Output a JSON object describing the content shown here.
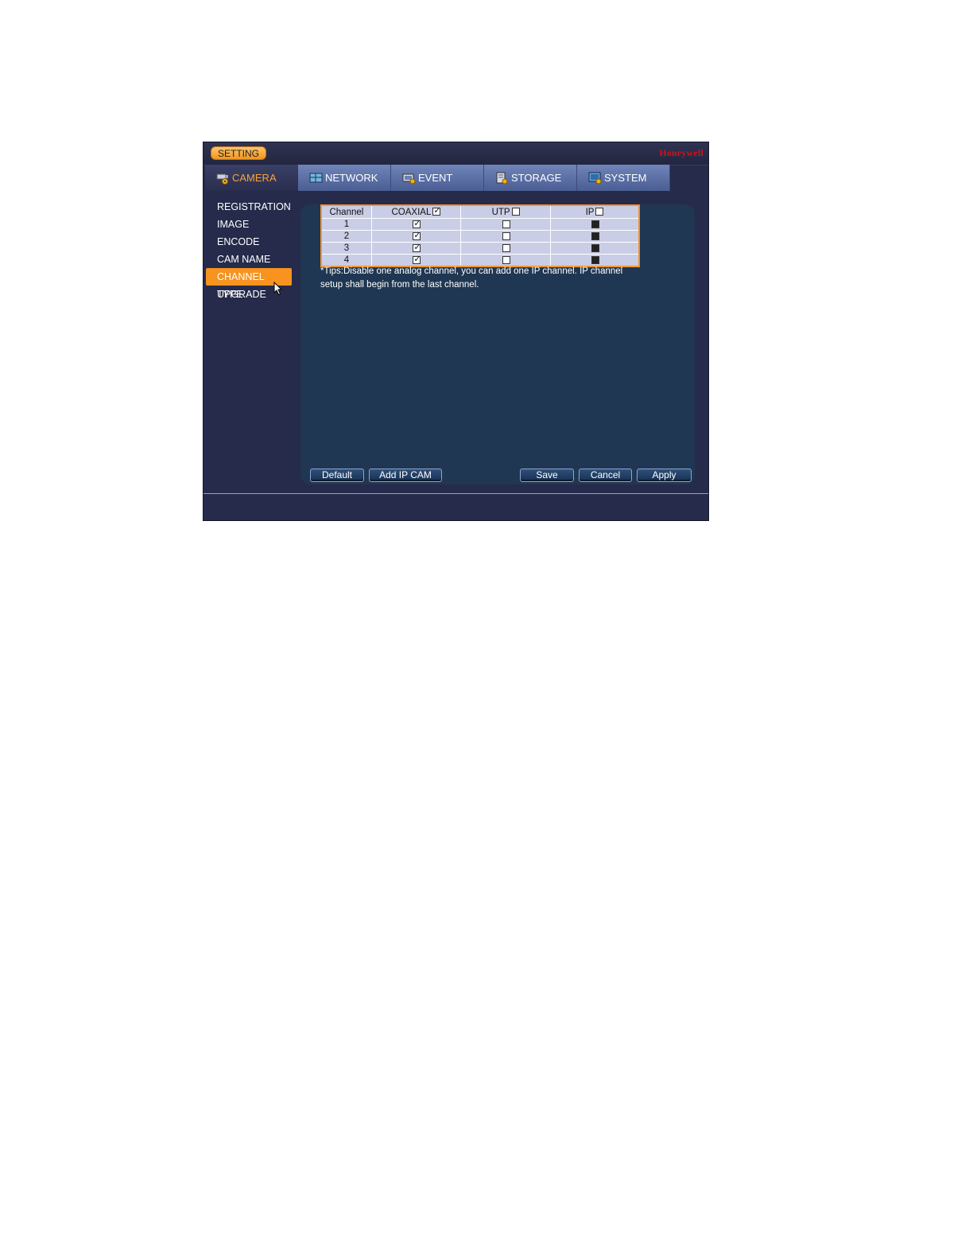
{
  "header": {
    "setting_label": "SETTING",
    "brand": "Honeywell"
  },
  "tabs": [
    {
      "label": "CAMERA",
      "icon": "camera-gear-icon",
      "active": true
    },
    {
      "label": "NETWORK",
      "icon": "network-icon"
    },
    {
      "label": "EVENT",
      "icon": "event-icon"
    },
    {
      "label": "STORAGE",
      "icon": "storage-icon"
    },
    {
      "label": "SYSTEM",
      "icon": "system-icon"
    }
  ],
  "sidebar": {
    "items": [
      {
        "label": "REGISTRATION"
      },
      {
        "label": "IMAGE"
      },
      {
        "label": "ENCODE"
      },
      {
        "label": "CAM NAME"
      },
      {
        "label": "CHANNEL TYPE",
        "active": true
      },
      {
        "label": "UPGRADE"
      }
    ]
  },
  "table": {
    "headers": {
      "channel": "Channel",
      "coaxial": "COAXIAL",
      "utp": "UTP",
      "ip": "IP"
    },
    "header_checks": {
      "coaxial": true,
      "utp": false,
      "ip": false
    },
    "rows": [
      {
        "channel": "1",
        "coaxial": true,
        "utp": false,
        "ip": "disabled"
      },
      {
        "channel": "2",
        "coaxial": true,
        "utp": false,
        "ip": "disabled"
      },
      {
        "channel": "3",
        "coaxial": true,
        "utp": false,
        "ip": "disabled"
      },
      {
        "channel": "4",
        "coaxial": true,
        "utp": false,
        "ip": "disabled"
      }
    ]
  },
  "tips": "*Tips:Disable one analog channel, you can add one IP channel. IP channel setup shall begin from the last channel.",
  "buttons": {
    "default": "Default",
    "add_ip_cam": "Add IP CAM",
    "save": "Save",
    "cancel": "Cancel",
    "apply": "Apply"
  },
  "colors": {
    "accent": "#f7931e",
    "brand": "#d0121b",
    "panel": "#1f3752",
    "window": "#262b4b"
  }
}
